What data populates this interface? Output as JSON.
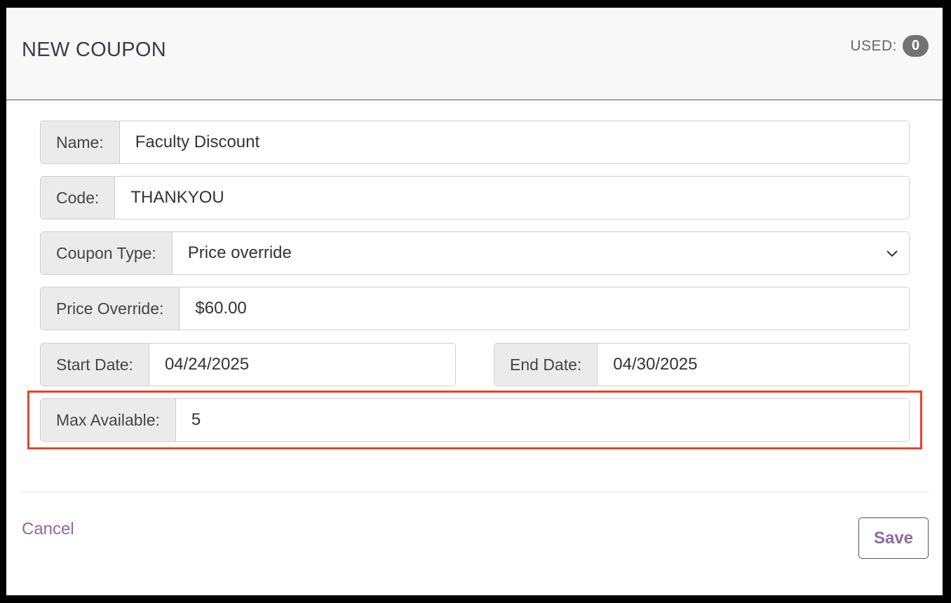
{
  "header": {
    "title": "NEW COUPON",
    "used_label": "USED:",
    "used_count": "0"
  },
  "form": {
    "name": {
      "label": "Name:",
      "value": "Faculty Discount"
    },
    "code": {
      "label": "Code:",
      "value": "THANKYOU"
    },
    "coupon_type": {
      "label": "Coupon Type:",
      "value": "Price override"
    },
    "price_override": {
      "label": "Price Override:",
      "value": "$60.00"
    },
    "start_date": {
      "label": "Start Date:",
      "value": "04/24/2025"
    },
    "end_date": {
      "label": "End Date:",
      "value": "04/30/2025"
    },
    "max_available": {
      "label": "Max Available:",
      "value": "5"
    }
  },
  "footer": {
    "cancel_label": "Cancel",
    "save_label": "Save"
  },
  "colors": {
    "accent": "#8e6aa0",
    "highlight": "#e2452c",
    "badge": "#727272"
  }
}
